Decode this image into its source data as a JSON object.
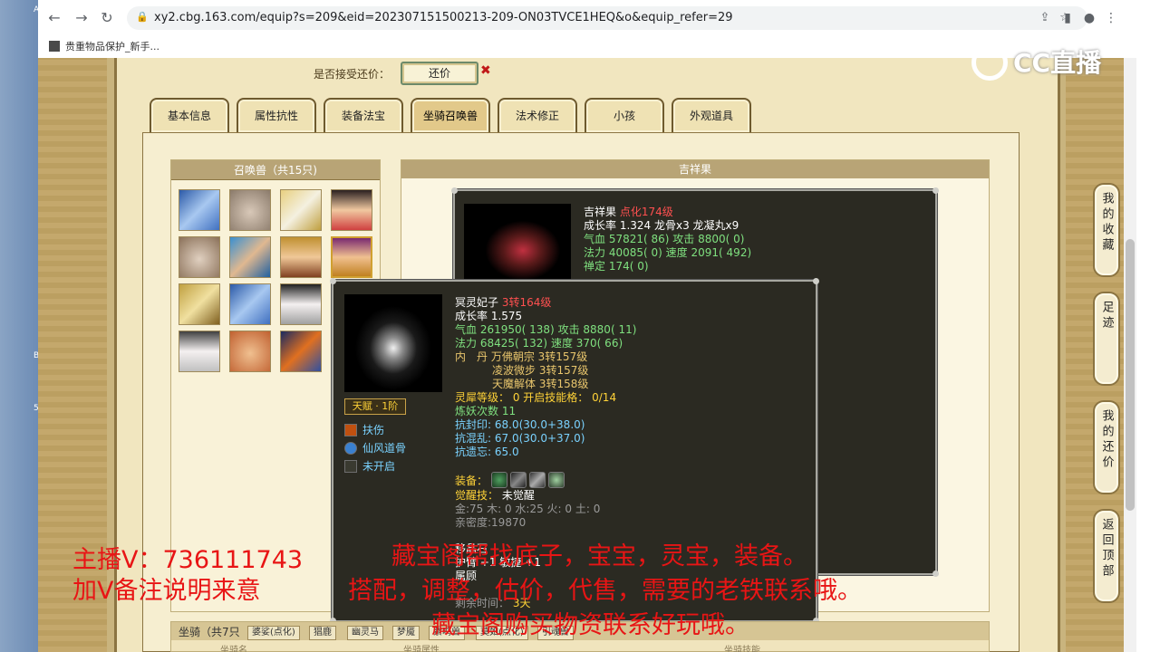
{
  "browser": {
    "url": "xy2.cbg.163.com/equip?s=209&eid=202307151500213-209-ON03TVCE1HEQ&o&equip_refer=29",
    "bookmark": "贵重物品保护_新手..."
  },
  "counter": {
    "label": "是否接受还价：",
    "button": "还价",
    "close": "✖"
  },
  "tabs": [
    "基本信息",
    "属性抗性",
    "装备法宝",
    "坐骑召唤兽",
    "法术修正",
    "小孩",
    "外观道具"
  ],
  "pet_panel": {
    "title": "召唤兽（共15只)"
  },
  "detail_panel": {
    "title": "吉祥果"
  },
  "popup1": {
    "name": "吉祥果",
    "level": "点化174级",
    "line1": "成长率 1.324 龙骨x3 龙凝丸x9",
    "hp_label": "气血",
    "hp_value": "57821( 86)",
    "atk_label": "攻击",
    "atk_value": "8800( 0)",
    "mp_label": "法力",
    "mp_value": "40085( 0)",
    "spd_label": "速度",
    "spd_value": "2091( 492)",
    "zen_label": "禅定",
    "zen_value": "174( 0)"
  },
  "popup2": {
    "name": "冥灵妃子",
    "level": "3转164级",
    "growth": "成长率 1.575",
    "hp_label": "气血",
    "hp_value": "261950( 138)",
    "atk_label": "攻击",
    "atk_value": "8880( 11)",
    "mp_label": "法力",
    "mp_value": "68425( 132)",
    "spd_label": "速度",
    "spd_value": "370( 66)",
    "dan_label": "内　丹",
    "dan1": "万佛朝宗 3转157级",
    "dan2": "凌波微步 3转157级",
    "dan3": "天魔解体 3转158级",
    "lingxi_label": "灵犀等级：",
    "lingxi_value": "0 开启技能格：",
    "lingxi_slots": "0/14",
    "lianyao": "炼妖次数 11",
    "kfy_label": "抗封印:",
    "kfy_value": "68.0(30.0+38.0)",
    "khl_label": "抗混乱:",
    "khl_value": "67.0(30.0+37.0)",
    "kyw_label": "抗遗忘:",
    "kyw_value": "65.0",
    "talent": "天赋 · 1阶",
    "skill1": "扶伤",
    "skill2": "仙风道骨",
    "skill3": "未开启",
    "equip_label": "装备：",
    "awaken_label": "觉醒技：",
    "awaken_value": "未觉醒",
    "elements": "金:75 木: 0 水:25 火: 0 土: 0",
    "intimacy": "亲密度:19870",
    "extra1": "移晶石",
    "extra2": "护臂 +1 敏捷 +1",
    "extra3": "属顾",
    "extra4": "剩余时间：",
    "extra4_value": "3天"
  },
  "mount_panel": {
    "title": "坐骑（共7只",
    "tabs": [
      "婆娑(点化)",
      "猖鹿",
      "幽灵马",
      "梦魇",
      "紫鸣兽",
      "莫如(点化)",
      "引魂兽"
    ],
    "col1": "坐骑名",
    "col2": "坐骑属性",
    "col3": "坐骑技能"
  },
  "side_nav": [
    {
      "label": "我的收藏"
    },
    {
      "label": "足迹"
    },
    {
      "label": "我的还价"
    },
    {
      "label": "返回顶部"
    }
  ],
  "overlay": {
    "logo": "CC直播",
    "line1": "主播V：736111743",
    "line2": "加V备注说明来意",
    "line3": "藏宝阁帮找底子，宝宝，灵宝，装备。",
    "line4": "搭配，调整，估价，代售，需要的老铁联系哦。",
    "line5": "藏宝阁购买物资联系好玩哦。"
  },
  "colors": {
    "overlay_red": "#e81515",
    "tooltip_bg": "#2b2a22",
    "stat_green": "#7fe07f",
    "level_red": "#ff5050"
  }
}
